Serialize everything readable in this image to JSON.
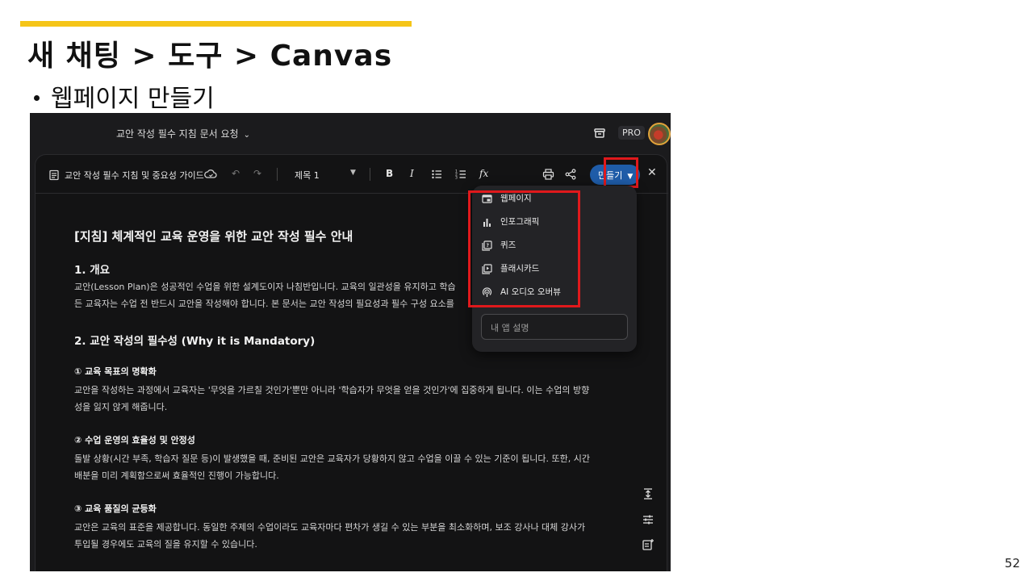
{
  "slide": {
    "title": "새 채팅 > 도구 > Canvas",
    "bullet": "웹페이지 만들기",
    "page_number": "52",
    "accent_color": "#f5c518"
  },
  "app": {
    "chat_title": "교안 작성 필수 지침 문서 요청",
    "pro_badge": "PRO",
    "icons": [
      "chevron-down-icon",
      "archive-icon",
      "avatar"
    ]
  },
  "toolbar": {
    "doc_title": "교안 작성 필수 지침 및 중요성 가이드",
    "text_style": "제목 1",
    "create_button": "만들기",
    "icons": [
      "document-icon",
      "cloud-save-icon",
      "undo-icon",
      "redo-icon",
      "bold-icon",
      "italic-icon",
      "bulleted-list-icon",
      "numbered-list-icon",
      "function-icon",
      "print-icon",
      "share-icon",
      "close-icon"
    ],
    "accent_color": "#1f5ca8"
  },
  "menu": {
    "items": [
      {
        "label": "웹페이지",
        "icon": "webpage-icon"
      },
      {
        "label": "인포그래픽",
        "icon": "bar-chart-icon"
      },
      {
        "label": "퀴즈",
        "icon": "quiz-icon"
      },
      {
        "label": "플래시카드",
        "icon": "flashcard-icon"
      },
      {
        "label": "AI 오디오 오버뷰",
        "icon": "podcast-icon"
      }
    ],
    "input_placeholder": "내 앱 설명",
    "highlight_color": "#e0191c"
  },
  "document": {
    "heading": "[지침] 체계적인 교육 운영을 위한 교안 작성 필수 안내",
    "s1_title": "1. 개요",
    "s1_p1": "교안(Lesson Plan)은 성공적인 수업을 위한 설계도이자 나침반입니다. 교육의 일관성을 유지하고 학습",
    "s1_p2": "든 교육자는 수업 전 반드시 교안을 작성해야 합니다. 본 문서는 교안 작성의 필요성과 필수 구성 요소를",
    "s2_title": "2. 교안 작성의 필수성 (Why it is Mandatory)",
    "sub1_title": "① 교육 목표의 명확화",
    "sub1_p1": "교안을 작성하는 과정에서 교육자는 '무엇을 가르칠 것인가'뿐만 아니라 '학습자가 무엇을 얻을 것인가'에 집중하게 됩니다. 이는 수업의 방향",
    "sub1_p2": "성을 잃지 않게 해줍니다.",
    "sub2_title": "② 수업 운영의 효율성 및 안정성",
    "sub2_p1": "돌발 상황(시간 부족, 학습자 질문 등)이 발생했을 때, 준비된 교안은 교육자가 당황하지 않고 수업을 이끌 수 있는 기준이 됩니다. 또한, 시간",
    "sub2_p2": "배분을 미리 계획함으로써 효율적인 진행이 가능합니다.",
    "sub3_title": "③ 교육 품질의 균등화",
    "sub3_p1": "교안은 교육의 표준을 제공합니다. 동일한 주제의 수업이라도 교육자마다 편차가 생길 수 있는 부분을 최소화하며, 보조 강사나 대체 강사가",
    "sub3_p2": "투입될 경우에도 교육의 질을 유지할 수 있습니다.",
    "side_icons": [
      "expand-vertical-icon",
      "tune-icon",
      "add-note-icon"
    ]
  }
}
